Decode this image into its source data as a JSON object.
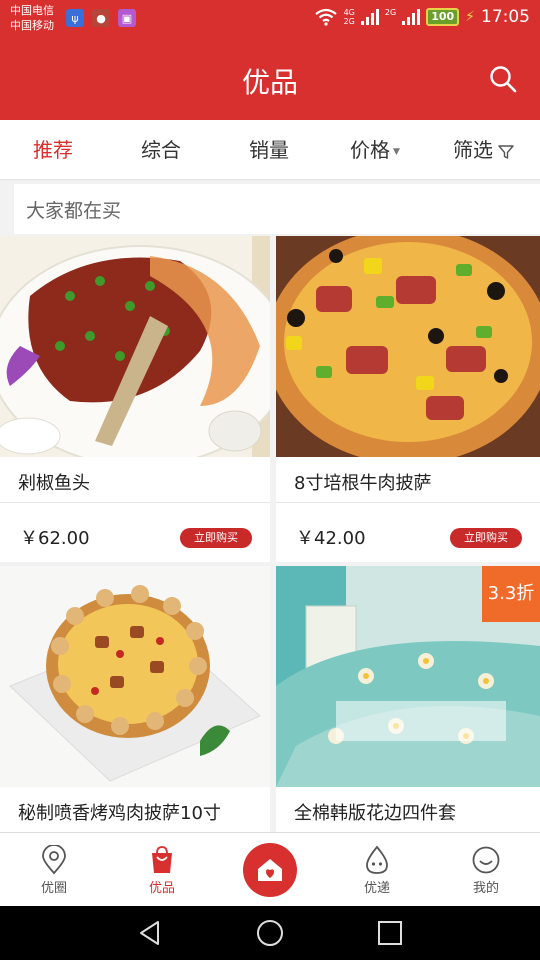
{
  "status_bar": {
    "carrier_1": "中国电信",
    "carrier_2": "中国移动",
    "net_1": "4G",
    "net_2": "2G",
    "net_3": "2G",
    "battery": "100",
    "time": "17:05"
  },
  "header": {
    "title": "优品"
  },
  "tabs": [
    {
      "label": "推荐",
      "active": true
    },
    {
      "label": "综合"
    },
    {
      "label": "销量"
    },
    {
      "label": "价格"
    },
    {
      "label": "筛选"
    }
  ],
  "section": {
    "title": "大家都在买"
  },
  "products": [
    {
      "name": "剁椒鱼头",
      "price": "￥62.00",
      "buy_label": "立即购买",
      "image": "steamed-fish-head-with-chopped-chili"
    },
    {
      "name": "8寸培根牛肉披萨",
      "price": "￥42.00",
      "buy_label": "立即购买",
      "image": "bacon-beef-pizza"
    },
    {
      "name": "秘制喷香烤鸡肉披萨10寸",
      "image": "roast-chicken-pizza"
    },
    {
      "name": "全棉韩版花边四件套",
      "discount": "3.3折",
      "image": "floral-bedding-set"
    }
  ],
  "bottom_nav": [
    {
      "label": "优圈",
      "icon": "location-pin-icon"
    },
    {
      "label": "优品",
      "icon": "shopping-bag-icon",
      "active": true
    },
    {
      "label": "",
      "icon": "home-icon"
    },
    {
      "label": "优递",
      "icon": "delivery-drop-icon"
    },
    {
      "label": "我的",
      "icon": "smiley-face-icon"
    }
  ],
  "colors": {
    "brand_red": "#d8302f",
    "buy_button": "#c82a2a",
    "discount_orange": "#f06a2a",
    "text_dark": "#222222"
  }
}
